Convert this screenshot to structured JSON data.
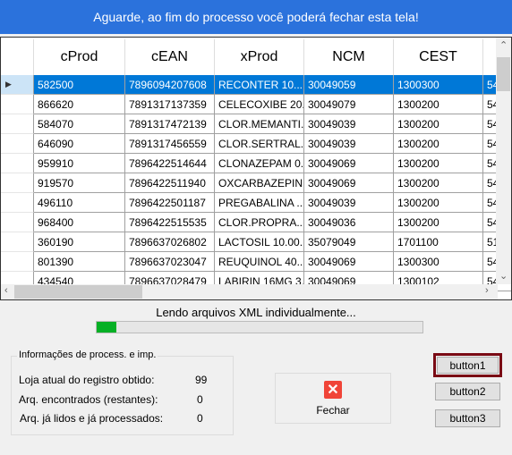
{
  "banner": {
    "text": "Aguarde, ao fim do processo você poderá fechar esta tela!"
  },
  "grid": {
    "columns": [
      "cProd",
      "cEAN",
      "xProd",
      "NCM",
      "CEST",
      ""
    ],
    "rows": [
      [
        "582500",
        "7896094207608",
        "RECONTER 10...",
        "30049059",
        "1300300",
        "54"
      ],
      [
        "866620",
        "7891317137359",
        "CELECOXIBE 20...",
        "30049079",
        "1300200",
        "54"
      ],
      [
        "584070",
        "7891317472139",
        "CLOR.MEMANTI...",
        "30049039",
        "1300200",
        "54"
      ],
      [
        "646090",
        "7891317456559",
        "CLOR.SERTRAL...",
        "30049039",
        "1300200",
        "54"
      ],
      [
        "959910",
        "7896422514644",
        "CLONAZEPAM 0...",
        "30049069",
        "1300200",
        "54"
      ],
      [
        "919570",
        "7896422511940",
        "OXCARBAZEPIN...",
        "30049069",
        "1300200",
        "54"
      ],
      [
        "496110",
        "7896422501187",
        "PREGABALINA ...",
        "30049039",
        "1300200",
        "54"
      ],
      [
        "968400",
        "7896422515535",
        "CLOR.PROPRA...",
        "30049036",
        "1300200",
        "54"
      ],
      [
        "360190",
        "7896637026802",
        "LACTOSIL 10.00...",
        "35079049",
        "1701100",
        "51"
      ],
      [
        "801390",
        "7896637023047",
        "REUQUINOL 40...",
        "30049069",
        "1300300",
        "54"
      ],
      [
        "434540",
        "7896637028479",
        "LABIRIN 16MG 3...",
        "30049069",
        "1300102",
        "54"
      ]
    ],
    "selected_row": 0
  },
  "progress": {
    "label": "Lendo arquivos XML individualmente...",
    "percent": 6,
    "color": "#06b025"
  },
  "info": {
    "title": "Informações de process. e imp.",
    "items": [
      {
        "label": "Loja atual do registro obtido:",
        "value": "99"
      },
      {
        "label": "Arq. encontrados (restantes):",
        "value": "0"
      },
      {
        "label": "Arq. já lidos e já processados:",
        "value": "0"
      }
    ]
  },
  "buttons": {
    "fechar": "Fechar",
    "button1": "button1",
    "button2": "button2",
    "button3": "button3"
  },
  "colors": {
    "banner": "#2b72dc",
    "selection": "#0078d7",
    "close_icon": "#f04438",
    "focus_border": "#7a0a14"
  }
}
